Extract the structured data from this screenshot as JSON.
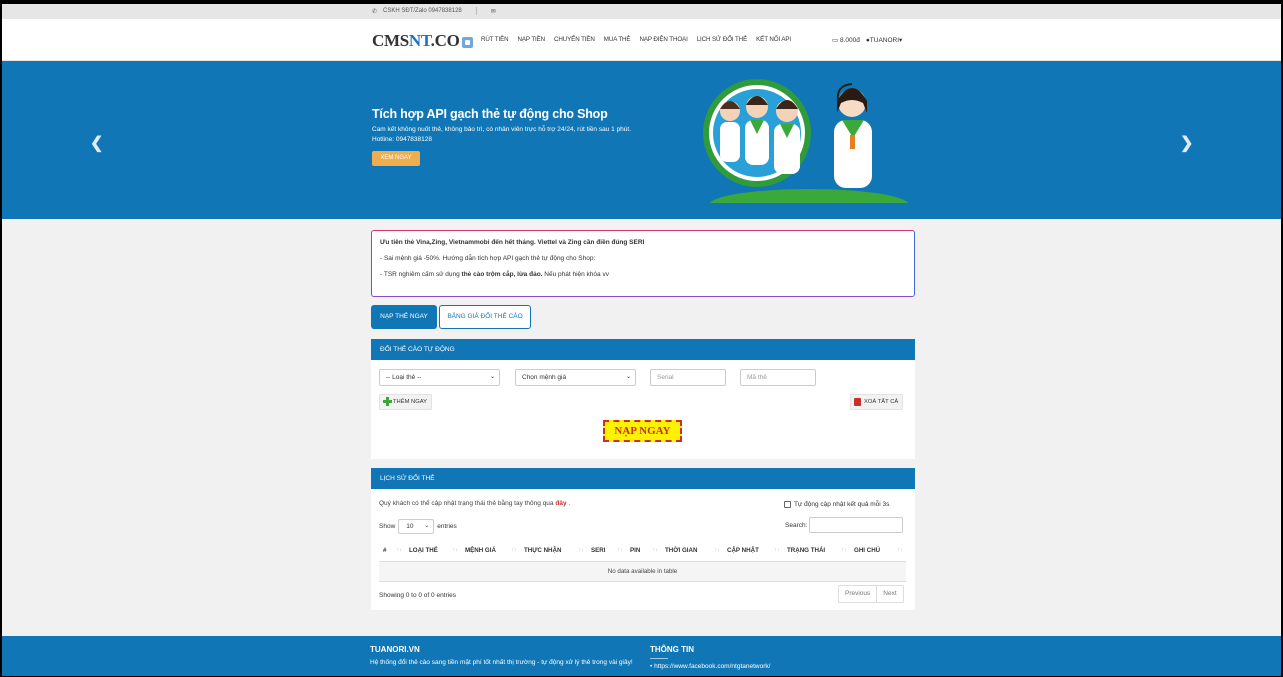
{
  "topbar": {
    "phone": "CSKH SĐT/Zalo 0947838128"
  },
  "logo": {
    "part1": "CMS",
    "part2": "NT",
    "part3": ".CO"
  },
  "menu": [
    "RÚT TIỀN",
    "NẠP TIỀN",
    "CHUYỂN TIỀN",
    "MUA THẺ",
    "NẠP ĐIỆN THOẠI",
    "LỊCH SỬ ĐỔI THẺ",
    "KẾT NỐI API"
  ],
  "account": {
    "balance": "8.000đ",
    "username": "TUANORI"
  },
  "hero": {
    "title": "Tích hợp API gạch thẻ tự động cho Shop",
    "desc": "Cam kết không nuốt thẻ, không bảo trì, có nhân viên trực hỗ trợ 24/24, rút tiền sau 1 phút. Hotline: 0947838128",
    "button": "XEM NGAY"
  },
  "notice": {
    "line1": "Ưu tiên thẻ Vina,Zing, Vietnammobi đến hết tháng. Viettel và Zing cần điền đúng SERI",
    "line2": "- Sai mệnh giá -50%. Hướng dẫn tích hợp API gạch thẻ tự động cho Shop:",
    "line3_pre": "- TSR nghiêm cấm sử dụng ",
    "line3_bold": "thẻ cào trộm cắp, lừa đảo.",
    "line3_post": " Nếu phát hiện khóa vv"
  },
  "tabs": {
    "active": "NẠP THẺ NGAY",
    "other": "BẢNG GIÁ ĐỔI THẺ CÀO"
  },
  "exchange": {
    "header": "ĐỔI THẺ CÀO TỰ ĐỘNG",
    "card_type": "-- Loại thẻ --",
    "denomination": "Chọn mệnh giá",
    "serial_placeholder": "Serial",
    "code_placeholder": "Mã thẻ",
    "add_label": "THÊM NGAY",
    "clear_label": "XOÁ TẤT CẢ",
    "submit_label": "NẠP NGAY"
  },
  "history": {
    "header": "LỊCH SỬ ĐỔI THẺ",
    "info_pre": "Quý khách có thể cập nhật trạng thái thẻ bằng tay thông qua ",
    "info_link": "đây",
    "info_post": " .",
    "auto_update": "Tự động cập nhật kết quả mỗi 3s",
    "show": "Show",
    "entries_value": "10",
    "entries": "entries",
    "search": "Search:",
    "columns": [
      "#",
      "LOẠI THẺ",
      "MỆNH GIÁ",
      "THỰC NHẬN",
      "SERI",
      "PIN",
      "THỜI GIAN",
      "CẬP NHẬT",
      "TRẠNG THÁI",
      "GHI CHÚ"
    ],
    "empty": "No data available in table",
    "showing": "Showing 0 to 0 of 0 entries",
    "prev": "Previous",
    "next": "Next"
  },
  "footer": {
    "title1": "TUANORI.VN",
    "text1": "Hệ thống đổi thẻ cào sang tiền mặt phí tốt nhất thị trường - tự động xử lý thẻ trong vài giây!",
    "title2": "THÔNG TIN",
    "link1": "https://www.facebook.com/ntgtanetwork/"
  },
  "colors": {
    "primary": "#1176b6",
    "accent": "#f0ad4e",
    "danger": "#c9302c",
    "highlight": "#fff200"
  }
}
